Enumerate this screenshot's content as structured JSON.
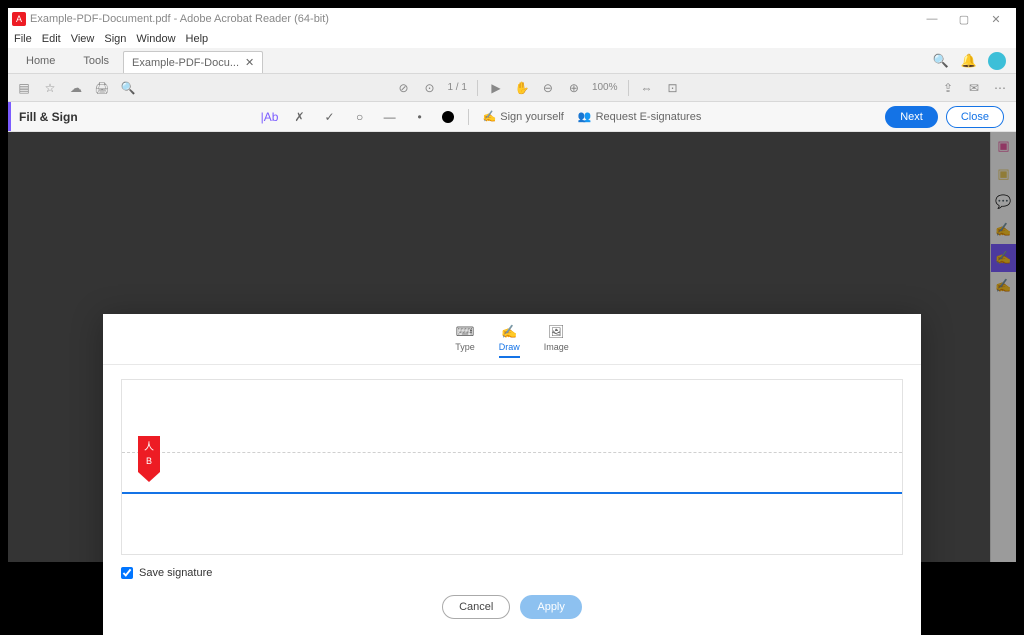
{
  "window": {
    "title": "Example-PDF-Document.pdf - Adobe Acrobat Reader (64-bit)"
  },
  "menubar": [
    "File",
    "Edit",
    "View",
    "Sign",
    "Window",
    "Help"
  ],
  "tabs": {
    "home": "Home",
    "tools": "Tools",
    "doc": "Example-PDF-Docu..."
  },
  "toolbar": {
    "page_count": "1 / 1",
    "zoom": "100%"
  },
  "fillsign": {
    "title": "Fill & Sign",
    "sign_yourself": "Sign yourself",
    "request_sigs": "Request E-signatures",
    "next": "Next",
    "close": "Close"
  },
  "modal": {
    "tabs": {
      "type": "Type",
      "draw": "Draw",
      "image": "Image"
    },
    "save_sig": "Save signature",
    "cancel": "Cancel",
    "apply": "Apply"
  }
}
